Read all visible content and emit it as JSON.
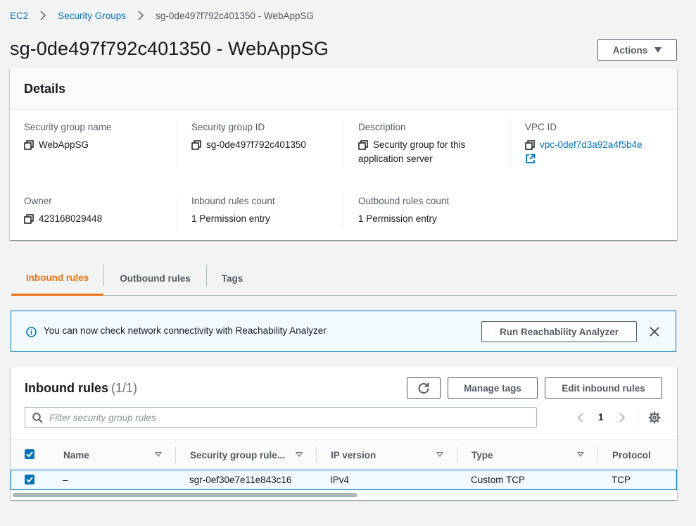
{
  "breadcrumb": {
    "items": [
      "EC2",
      "Security Groups"
    ],
    "current": "sg-0de497f792c401350 - WebAppSG"
  },
  "page_title": "sg-0de497f792c401350 - WebAppSG",
  "actions_label": "Actions",
  "details": {
    "title": "Details",
    "security_group_name": {
      "label": "Security group name",
      "value": "WebAppSG"
    },
    "security_group_id": {
      "label": "Security group ID",
      "value": "sg-0de497f792c401350"
    },
    "description": {
      "label": "Description",
      "value_line1": "Security group for this",
      "value_line2": "application server"
    },
    "vpc_id": {
      "label": "VPC ID",
      "value": "vpc-0def7d3a92a4f5b4e"
    },
    "owner": {
      "label": "Owner",
      "value": "423168029448"
    },
    "inbound_count": {
      "label": "Inbound rules count",
      "value": "1 Permission entry"
    },
    "outbound_count": {
      "label": "Outbound rules count",
      "value": "1 Permission entry"
    }
  },
  "tabs": [
    {
      "label": "Inbound rules",
      "active": true
    },
    {
      "label": "Outbound rules",
      "active": false
    },
    {
      "label": "Tags",
      "active": false
    }
  ],
  "banner": {
    "text": "You can now check network connectivity with Reachability Analyzer",
    "button_label": "Run Reachability Analyzer"
  },
  "rules": {
    "title": "Inbound rules",
    "count": "(1/1)",
    "manage_tags_label": "Manage tags",
    "edit_label": "Edit inbound rules",
    "search_placeholder": "Filter security group rules",
    "page": "1",
    "columns": [
      "Name",
      "Security group rule...",
      "IP version",
      "Type",
      "Protocol"
    ],
    "rows": [
      {
        "name": "–",
        "rule_id": "sgr-0ef30e7e11e843c16",
        "ip_version": "IPv4",
        "type": "Custom TCP",
        "protocol": "TCP",
        "selected": true
      }
    ]
  },
  "colors": {
    "link": "#0073bb",
    "active_tab": "#ec7211",
    "banner_bg": "#f1faff",
    "checkbox": "#0073bb"
  }
}
